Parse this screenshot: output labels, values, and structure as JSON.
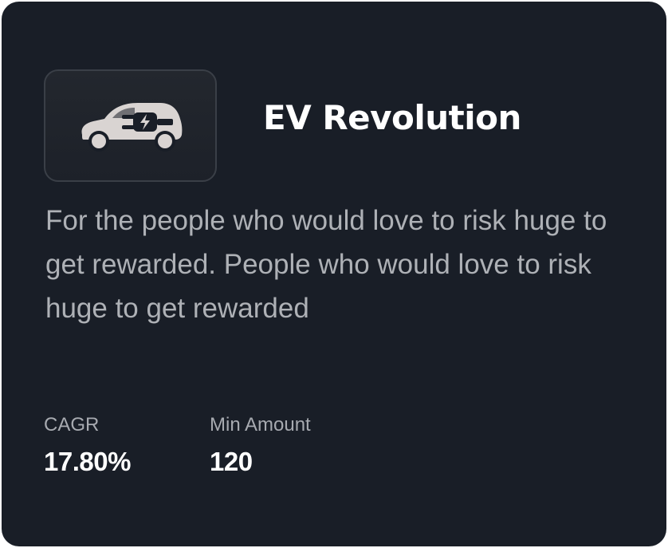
{
  "card": {
    "icon": "electric-car-icon",
    "title": "EV Revolution",
    "description": "For the people who would love to risk huge to get rewarded. People who would love to risk huge to get rewarded",
    "stats": [
      {
        "label": "CAGR",
        "value": "17.80%"
      },
      {
        "label": "Min Amount",
        "value": "120"
      }
    ]
  },
  "colors": {
    "card_background": "#191e27",
    "title": "#ffffff",
    "description": "#aeb1b6",
    "icon_fill": "#d9d4d2"
  }
}
